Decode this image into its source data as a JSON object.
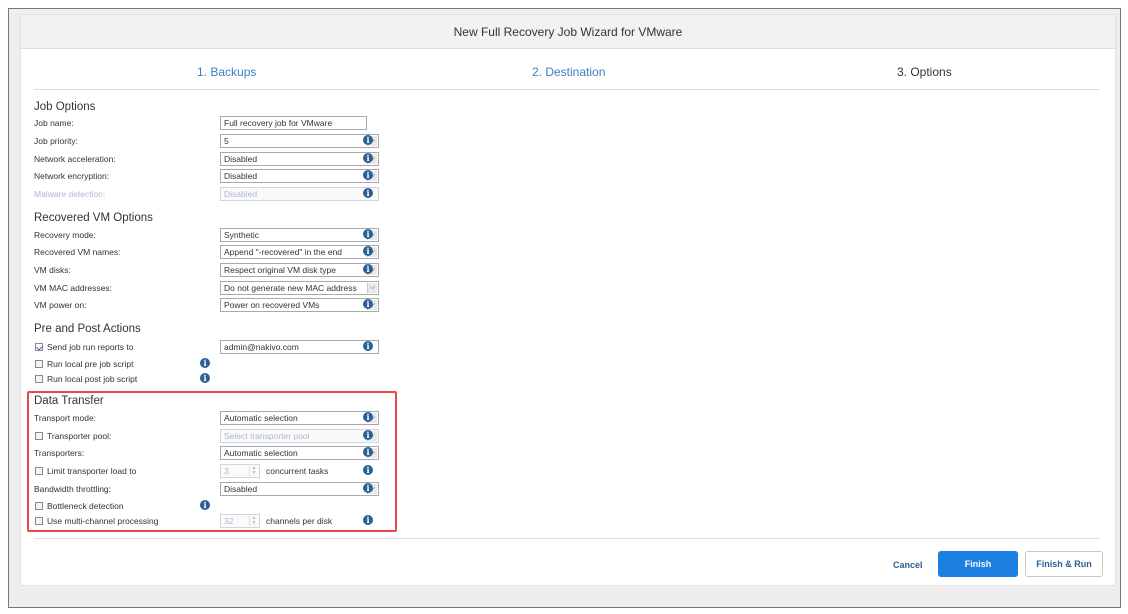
{
  "dialog": {
    "title": "New Full Recovery Job Wizard for VMware",
    "steps": [
      "1. Backups",
      "2. Destination",
      "3. Options"
    ]
  },
  "job_options": {
    "title": "Job Options",
    "job_name_label": "Job name:",
    "job_name_value": "Full recovery job for VMware",
    "job_priority_label": "Job priority:",
    "job_priority_value": "5",
    "network_acceleration_label": "Network acceleration:",
    "network_acceleration_value": "Disabled",
    "network_encryption_label": "Network encryption:",
    "network_encryption_value": "Disabled",
    "malware_detection_label": "Malware detection:",
    "malware_detection_value": "Disabled"
  },
  "recovered_vm_options": {
    "title": "Recovered VM Options",
    "recovery_mode_label": "Recovery mode:",
    "recovery_mode_value": "Synthetic",
    "vm_names_label": "Recovered VM names:",
    "vm_names_value": "Append \"-recovered\" in the end",
    "vm_disks_label": "VM disks:",
    "vm_disks_value": "Respect original VM disk type",
    "vm_mac_label": "VM MAC addresses:",
    "vm_mac_value": "Do not generate new MAC address",
    "vm_power_label": "VM power on:",
    "vm_power_value": "Power on recovered VMs"
  },
  "pre_post_actions": {
    "title": "Pre and Post Actions",
    "send_reports_label": "Send job run reports to",
    "send_reports_value": "admin@nakivo.com",
    "pre_script_label": "Run local pre job script",
    "post_script_label": "Run local post job script"
  },
  "data_transfer": {
    "title": "Data Transfer",
    "transport_mode_label": "Transport mode:",
    "transport_mode_value": "Automatic selection",
    "transporter_pool_label": "Transporter pool:",
    "transporter_pool_placeholder": "Select transporter pool",
    "transporters_label": "Transporters:",
    "transporters_value": "Automatic selection",
    "limit_load_label": "Limit transporter load to",
    "limit_load_value": "3",
    "limit_load_suffix": "concurrent tasks",
    "bandwidth_label": "Bandwidth throttling:",
    "bandwidth_value": "Disabled",
    "bottleneck_label": "Bottleneck detection",
    "multichannel_label": "Use multi-channel processing",
    "multichannel_value": "32",
    "multichannel_suffix": "channels per disk"
  },
  "footer": {
    "cancel": "Cancel",
    "finish": "Finish",
    "finish_run": "Finish & Run"
  },
  "colors": {
    "accent": "#1a7fe0",
    "highlight_border": "#e8474a",
    "info_icon": "#2b5f94"
  }
}
